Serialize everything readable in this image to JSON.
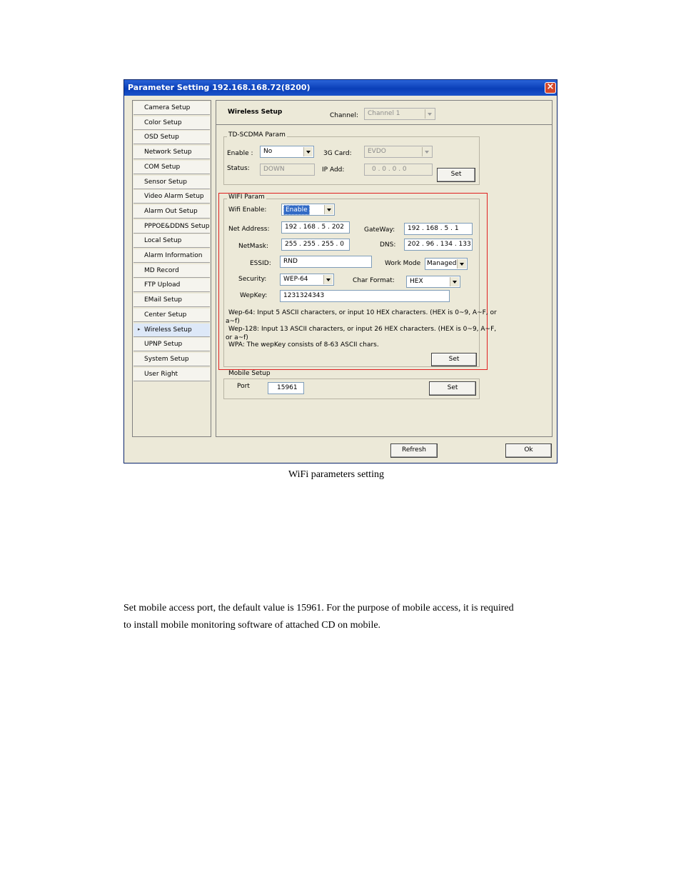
{
  "window": {
    "title": "Parameter Setting 192.168.168.72(8200)",
    "close_glyph": "×"
  },
  "sidebar": {
    "items": [
      {
        "label": "Camera Setup"
      },
      {
        "label": "Color Setup"
      },
      {
        "label": "OSD Setup"
      },
      {
        "label": "Network Setup"
      },
      {
        "label": "COM Setup"
      },
      {
        "label": "Sensor Setup"
      },
      {
        "label": "Video Alarm Setup"
      },
      {
        "label": "Alarm Out Setup"
      },
      {
        "label": "PPPOE&DDNS Setup"
      },
      {
        "label": "Local Setup"
      },
      {
        "label": "Alarm Information"
      },
      {
        "label": "MD Record"
      },
      {
        "label": "FTP Upload"
      },
      {
        "label": "EMail Setup"
      },
      {
        "label": "Center Setup"
      },
      {
        "label": "Wireless Setup",
        "selected": true
      },
      {
        "label": "UPNP Setup"
      },
      {
        "label": "System Setup"
      },
      {
        "label": "User Right"
      }
    ],
    "active_marker": "▸"
  },
  "header": {
    "section_title": "Wireless Setup",
    "channel_label": "Channel:",
    "channel_value": "Channel 1"
  },
  "td_scdma": {
    "legend": "TD-SCDMA Param",
    "enable_label": "Enable :",
    "enable_value": "No",
    "card_label": "3G Card:",
    "card_value": "EVDO",
    "status_label": "Status:",
    "status_value": "DOWN",
    "ip_label": "IP Add:",
    "ip_value": "0  .  0  .  0  .  0",
    "set_label": "Set"
  },
  "wifi": {
    "legend": "WIFI Param",
    "enable_label": "Wifi Enable:",
    "enable_value": "Enable",
    "net_label": "Net Address:",
    "net_value": "192 . 168 .  5  . 202",
    "gateway_label": "GateWay:",
    "gateway_value": "192 . 168 .  5  .  1",
    "netmask_label": "NetMask:",
    "netmask_value": "255 . 255 . 255 .  0",
    "dns_label": "DNS:",
    "dns_value": "202 . 96 . 134 . 133",
    "essid_label": "ESSID:",
    "essid_value": "RND",
    "workmode_label": "Work Mode",
    "workmode_value": "Managed",
    "security_label": "Security:",
    "security_value": "WEP-64",
    "charformat_label": "Char Format:",
    "charformat_value": "HEX",
    "wepkey_label": "WepKey:",
    "wepkey_value": "1231324343",
    "help_line1": "Wep-64: Input 5 ASCII characters, or input 10 HEX characters. (HEX is 0~9, A~F, or",
    "help_line2": "a~f)",
    "help_line3": "Wep-128: Input 13 ASCII characters, or input 26 HEX characters. (HEX is 0~9, A~F,",
    "help_line4": "or a~f)",
    "help_line5": "WPA: The wepKey consists of 8-63 ASCII chars.",
    "set_label": "Set"
  },
  "mobile": {
    "legend": "Mobile Setup",
    "port_label": "Port",
    "port_value": "15961",
    "set_label": "Set"
  },
  "footer": {
    "refresh_label": "Refresh",
    "ok_label": "Ok"
  },
  "document": {
    "caption": "WiFi parameters setting",
    "paragraph_line1": "Set mobile access port, the default value is 15961. For the purpose of mobile access, it is required",
    "paragraph_line2": "to install mobile monitoring software of attached CD on mobile."
  },
  "colors": {
    "titlebar": "#0a3fb8",
    "highlight_box": "#e02020",
    "selection": "#316ac5"
  }
}
